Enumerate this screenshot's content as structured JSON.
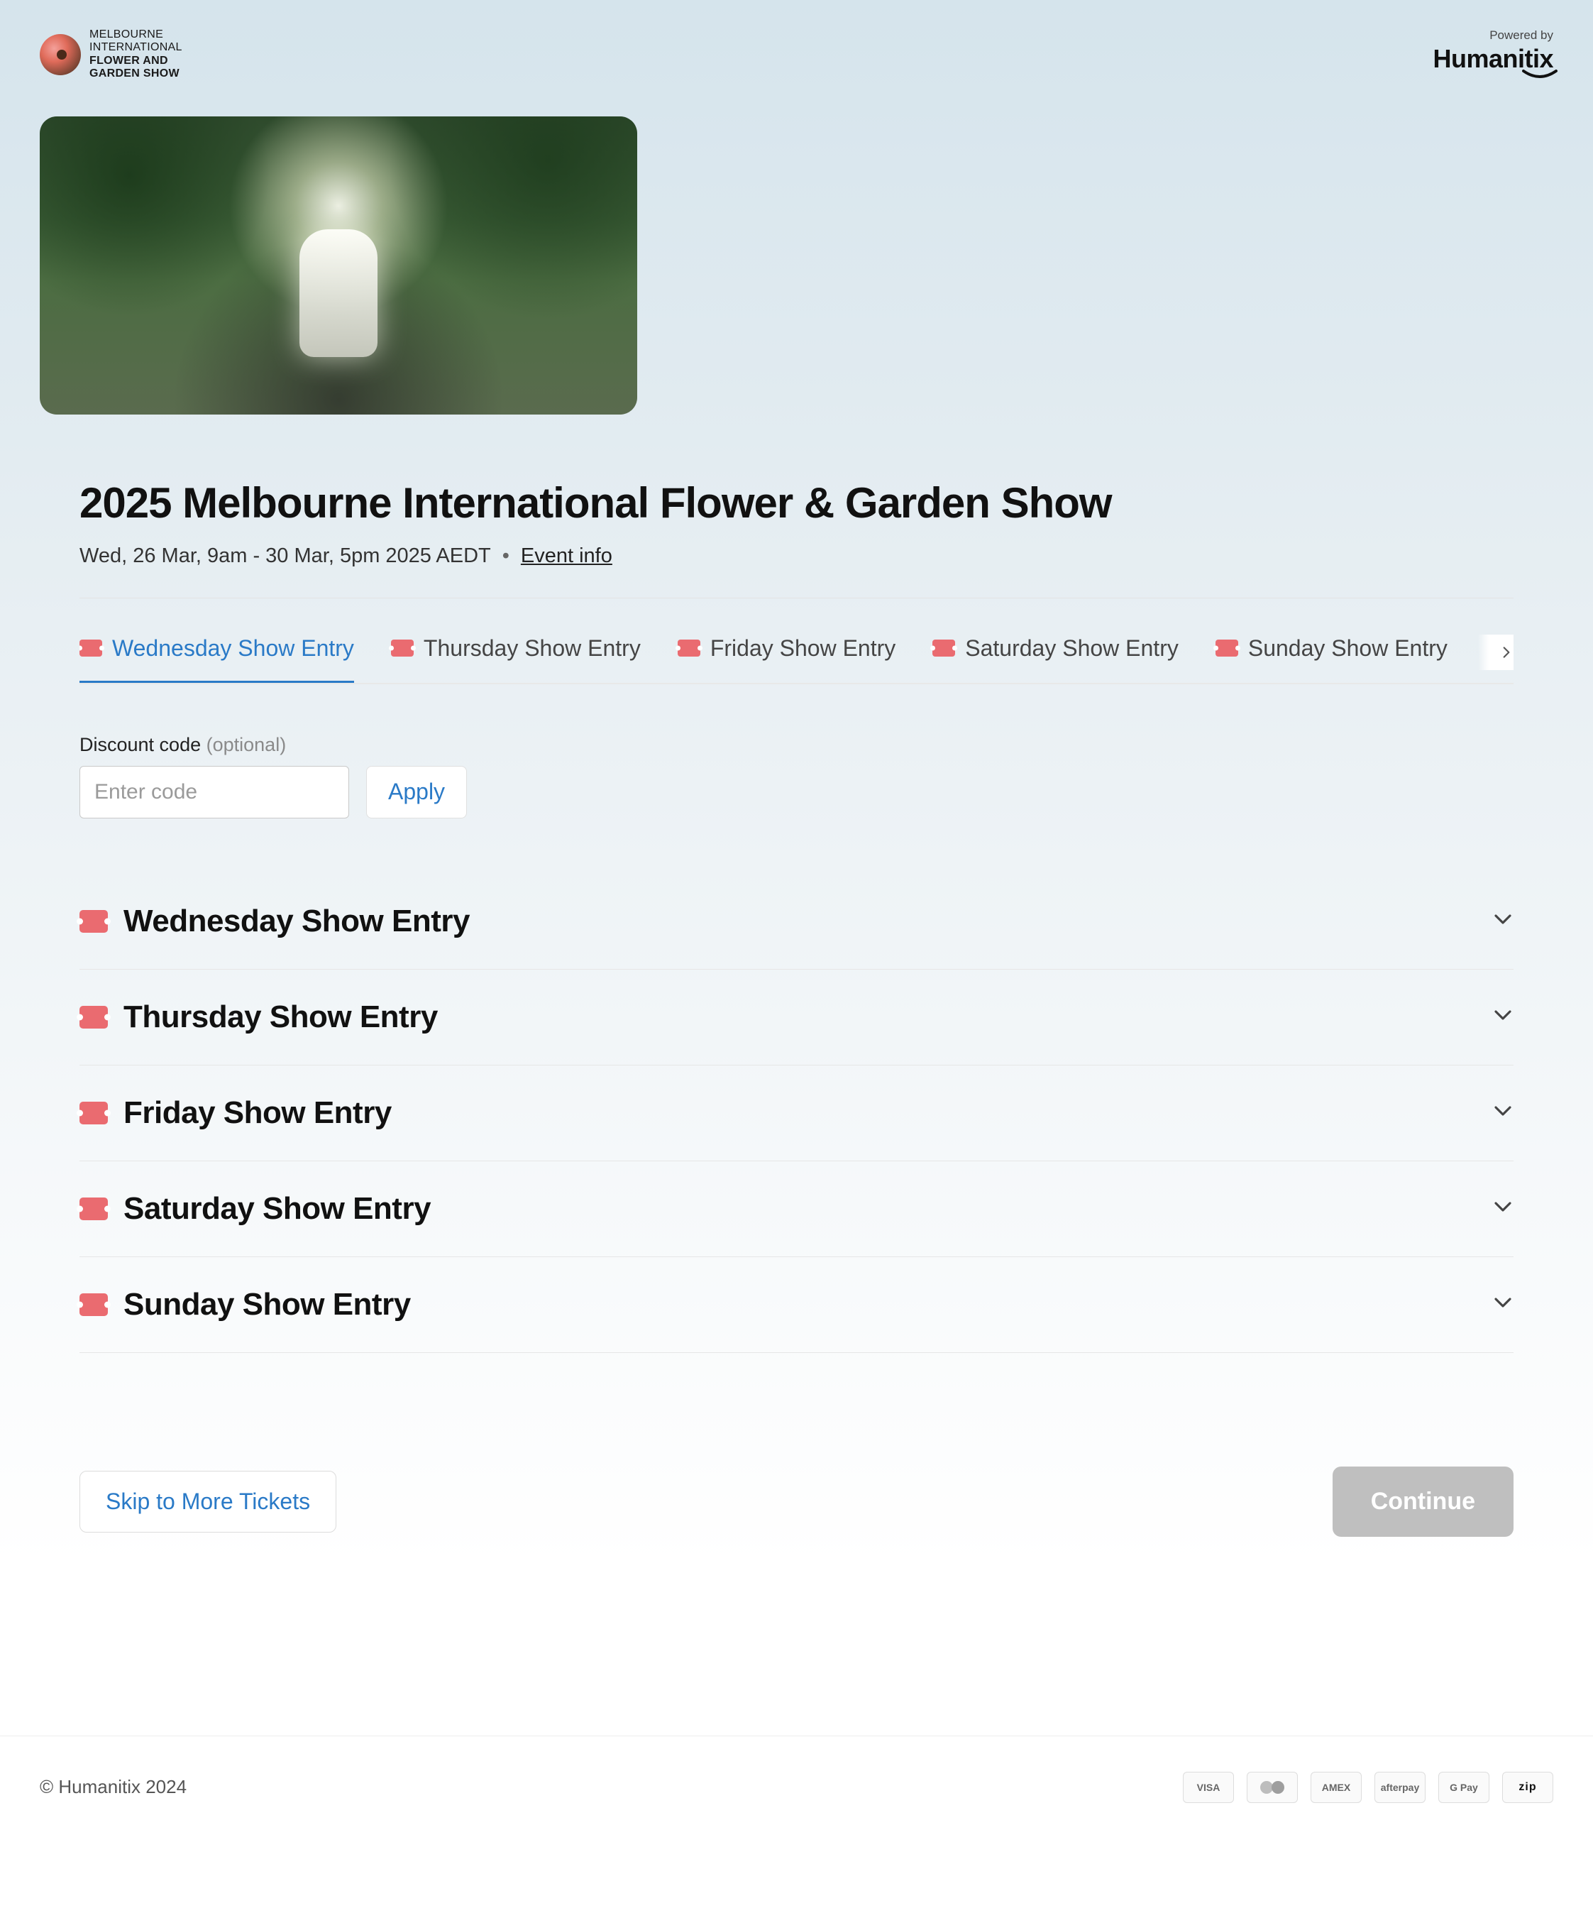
{
  "header": {
    "logo_lines": {
      "l1": "MELBOURNE",
      "l2": "INTERNATIONAL",
      "l3": "FLOWER AND",
      "l4": "GARDEN SHOW"
    },
    "powered_label": "Powered by",
    "powered_brand": "Humanitix"
  },
  "event": {
    "title": "2025 Melbourne International Flower & Garden Show",
    "datetime": "Wed, 26 Mar, 9am - 30 Mar, 5pm 2025 AEDT",
    "info_link": "Event info"
  },
  "tabs": [
    {
      "label": "Wednesday Show Entry",
      "active": true
    },
    {
      "label": "Thursday Show Entry",
      "active": false
    },
    {
      "label": "Friday Show Entry",
      "active": false
    },
    {
      "label": "Saturday Show Entry",
      "active": false
    },
    {
      "label": "Sunday Show Entry",
      "active": false
    }
  ],
  "discount": {
    "label": "Discount code",
    "optional": "(optional)",
    "placeholder": "Enter code",
    "apply": "Apply"
  },
  "sections": [
    {
      "title": "Wednesday Show Entry"
    },
    {
      "title": "Thursday Show Entry"
    },
    {
      "title": "Friday Show Entry"
    },
    {
      "title": "Saturday Show Entry"
    },
    {
      "title": "Sunday Show Entry"
    }
  ],
  "actions": {
    "skip": "Skip to More Tickets",
    "continue": "Continue"
  },
  "footer": {
    "copyright": "© Humanitix 2024",
    "payments": [
      "VISA",
      "",
      "AMEX",
      "afterpay",
      "G Pay",
      "zip"
    ]
  }
}
